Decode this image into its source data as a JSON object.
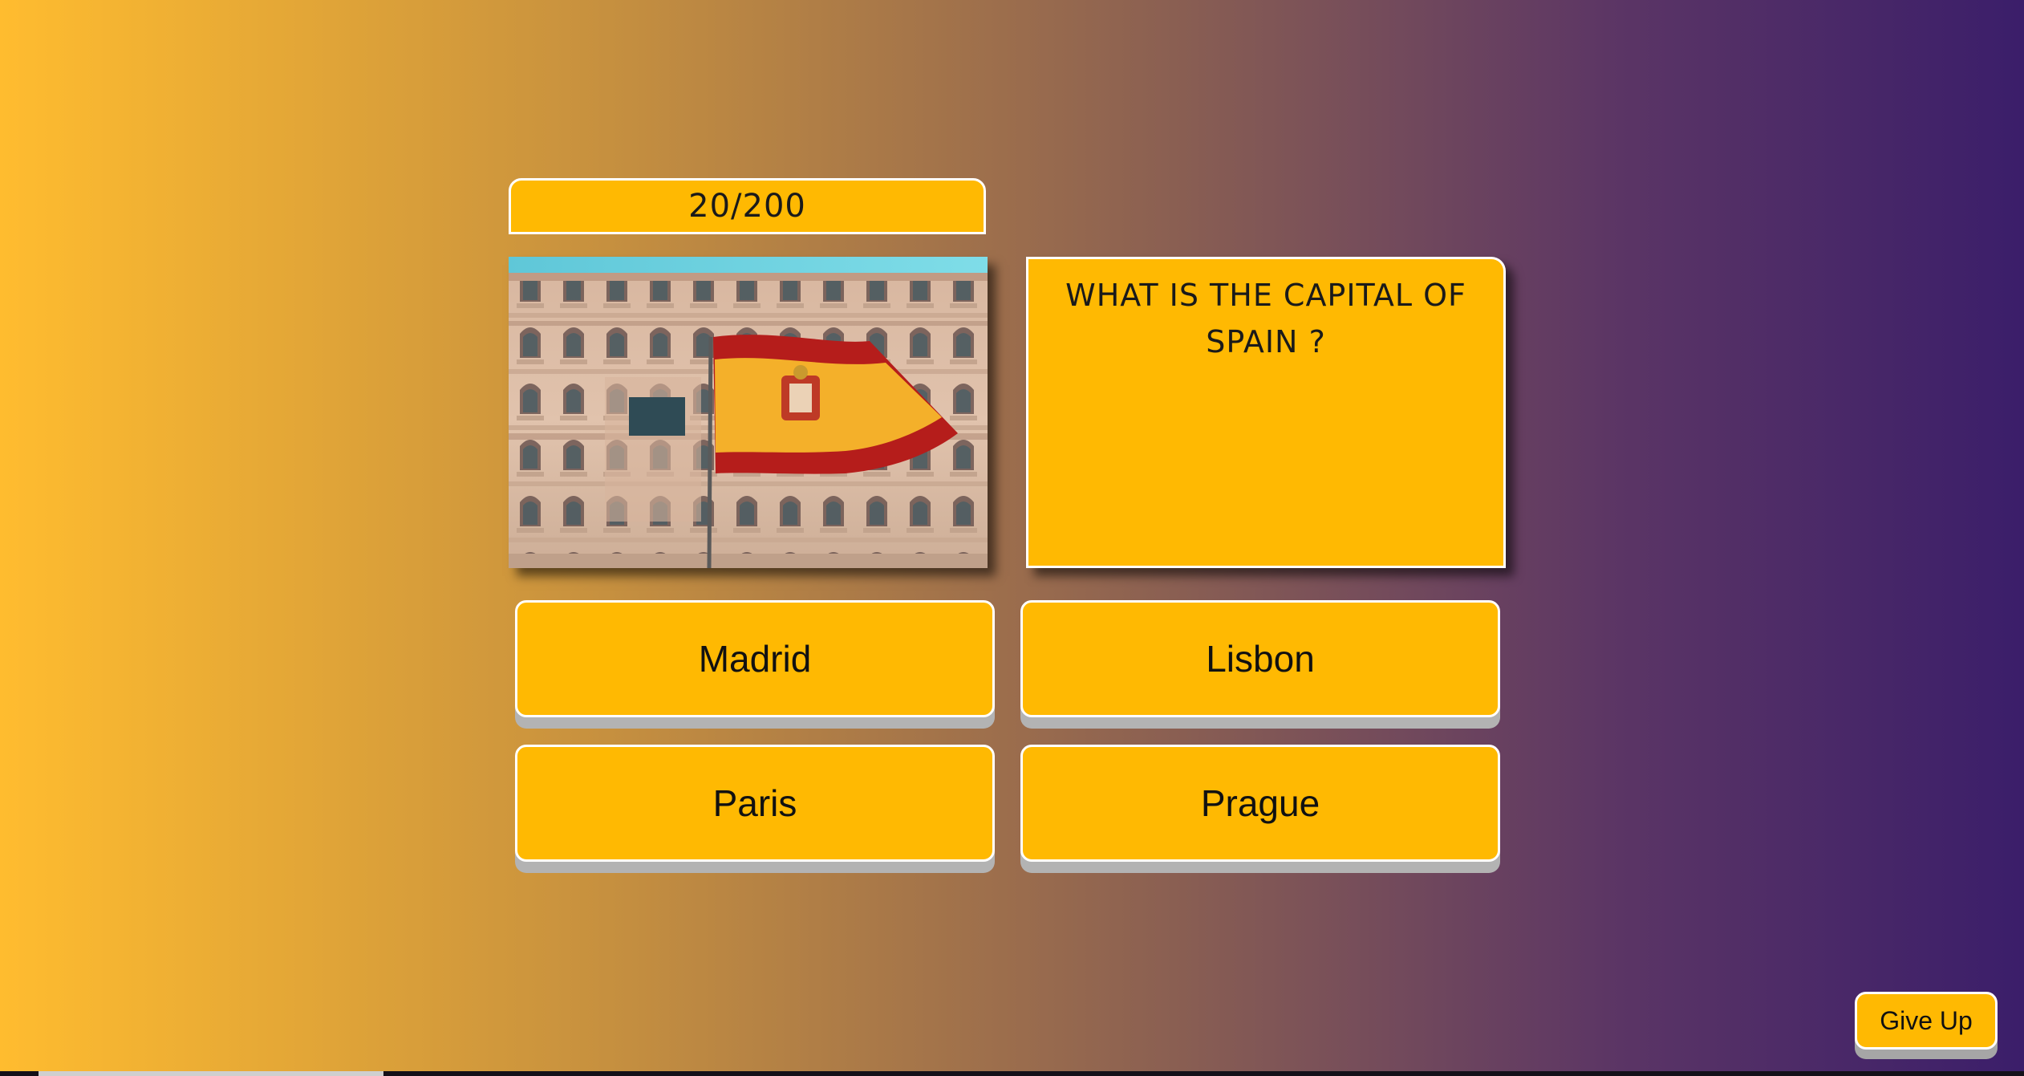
{
  "colors": {
    "accent": "#ffb902",
    "border": "#ffffff",
    "gradient_start": "#ffbc2f",
    "gradient_end": "#3b1e6a"
  },
  "quiz": {
    "progress_text": "20/200",
    "question": "WHAT IS THE CAPITAL OF SPAIN ?",
    "image_subject": "spanish-flag-on-building",
    "answers": [
      "Madrid",
      "Lisbon",
      "Paris",
      "Prague"
    ]
  },
  "actions": {
    "give_up_label": "Give Up"
  }
}
